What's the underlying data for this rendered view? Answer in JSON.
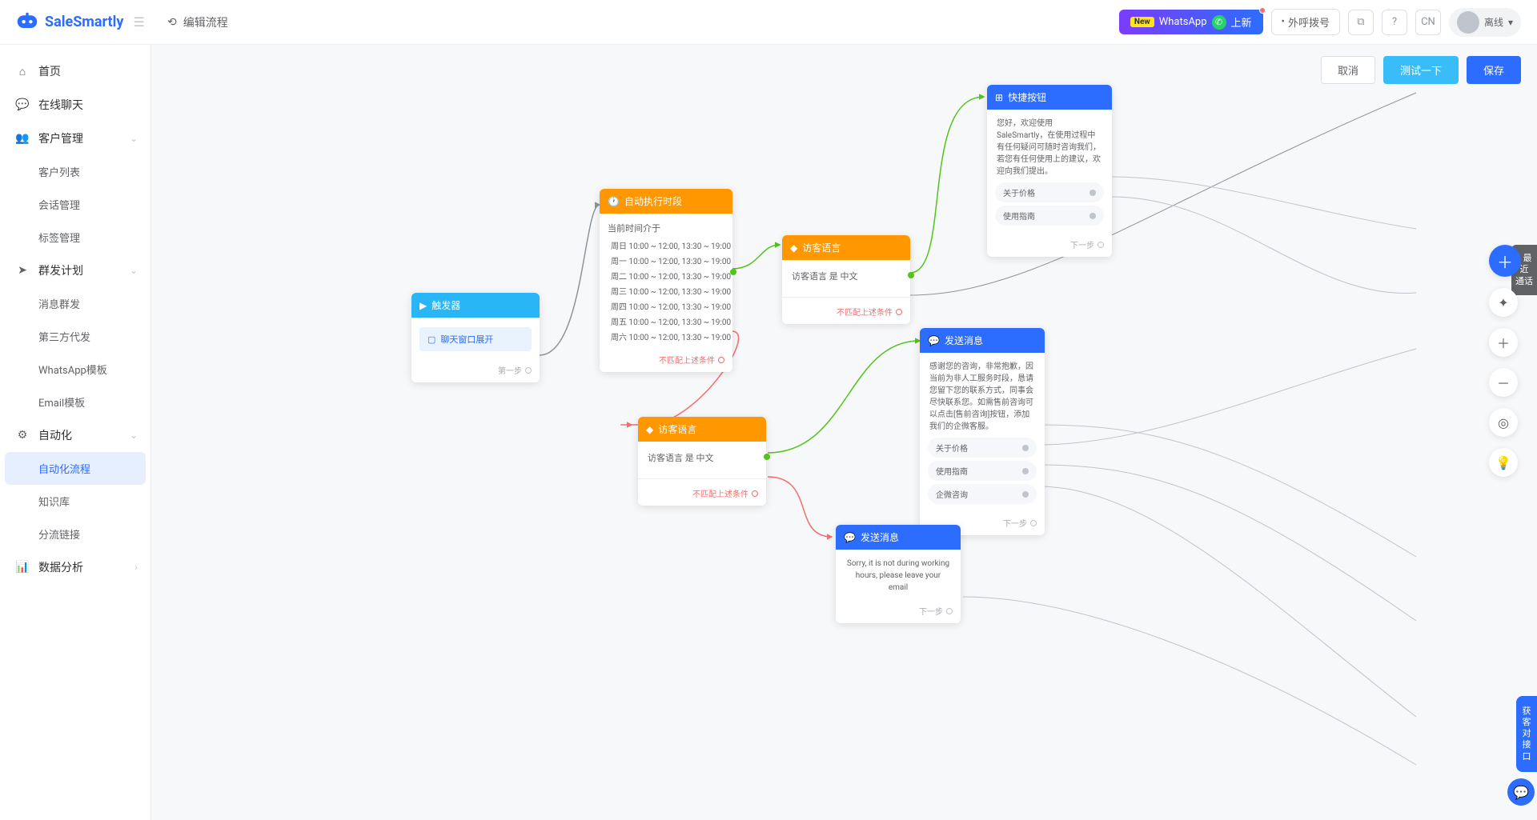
{
  "header": {
    "logo_text": "SaleSmartly",
    "page_title": "编辑流程",
    "whatsapp_banner": {
      "new_tag": "New",
      "text": "WhatsApp",
      "suffix": "上新"
    },
    "dial_btn": "外呼拨号",
    "lang_label": "CN",
    "status_label": "离线"
  },
  "sidebar": {
    "home": "首页",
    "chat": "在线聊天",
    "customer_mgmt": "客户管理",
    "customer_list": "客户列表",
    "session_mgmt": "会话管理",
    "tag_mgmt": "标签管理",
    "broadcast": "群发计划",
    "msg_broadcast": "消息群发",
    "third_party": "第三方代发",
    "whatsapp_tpl": "WhatsApp模板",
    "email_tpl": "Email模板",
    "automation": "自动化",
    "automation_flow": "自动化流程",
    "knowledge": "知识库",
    "route_link": "分流链接",
    "data_analysis": "数据分析"
  },
  "actions": {
    "cancel": "取消",
    "test": "测试一下",
    "save": "保存"
  },
  "nodes": {
    "trigger": {
      "title": "触发器",
      "chip": "聊天窗口展开",
      "next": "第一步"
    },
    "schedule": {
      "title": "自动执行时段",
      "subtitle": "当前时间介于",
      "rows": [
        "周日 10:00 ~ 12:00, 13:30 ~ 19:00",
        "周一 10:00 ~ 12:00, 13:30 ~ 19:00",
        "周二 10:00 ~ 12:00, 13:30 ~ 19:00",
        "周三 10:00 ~ 12:00, 13:30 ~ 19:00",
        "周四 10:00 ~ 12:00, 13:30 ~ 19:00",
        "周五 10:00 ~ 12:00, 13:30 ~ 19:00",
        "周六 10:00 ~ 12:00, 13:30 ~ 19:00"
      ],
      "no_match": "不匹配上述条件"
    },
    "lang1": {
      "title": "访客语言",
      "cond": "访客语言 是 中文",
      "no_match": "不匹配上述条件"
    },
    "lang2": {
      "title": "访客语言",
      "cond": "访客语言 是 中文",
      "no_match": "不匹配上述条件"
    },
    "quick": {
      "title": "快捷按钮",
      "msg": "您好，欢迎使用SaleSmartly，在使用过程中有任何疑问可随时咨询我们，若您有任何使用上的建议，欢迎向我们提出。",
      "opt1": "关于价格",
      "opt2": "使用指南",
      "next": "下一步"
    },
    "send1": {
      "title": "发送消息",
      "msg": "感谢您的咨询，非常抱歉，因当前为非人工服务时段，恳请您留下您的联系方式，同事会尽快联系您。如需售前咨询可以点击[售前咨询]按钮，添加我们的企微客服。",
      "opt1": "关于价格",
      "opt2": "使用指南",
      "opt3": "企微咨询",
      "next": "下一步"
    },
    "send2": {
      "title": "发送消息",
      "msg": "Sorry, it is not during working hours, please leave your email",
      "next": "下一步"
    }
  },
  "side_tab": "最近\n通话",
  "consult_tab": "获\n客\n对\n接\n口"
}
